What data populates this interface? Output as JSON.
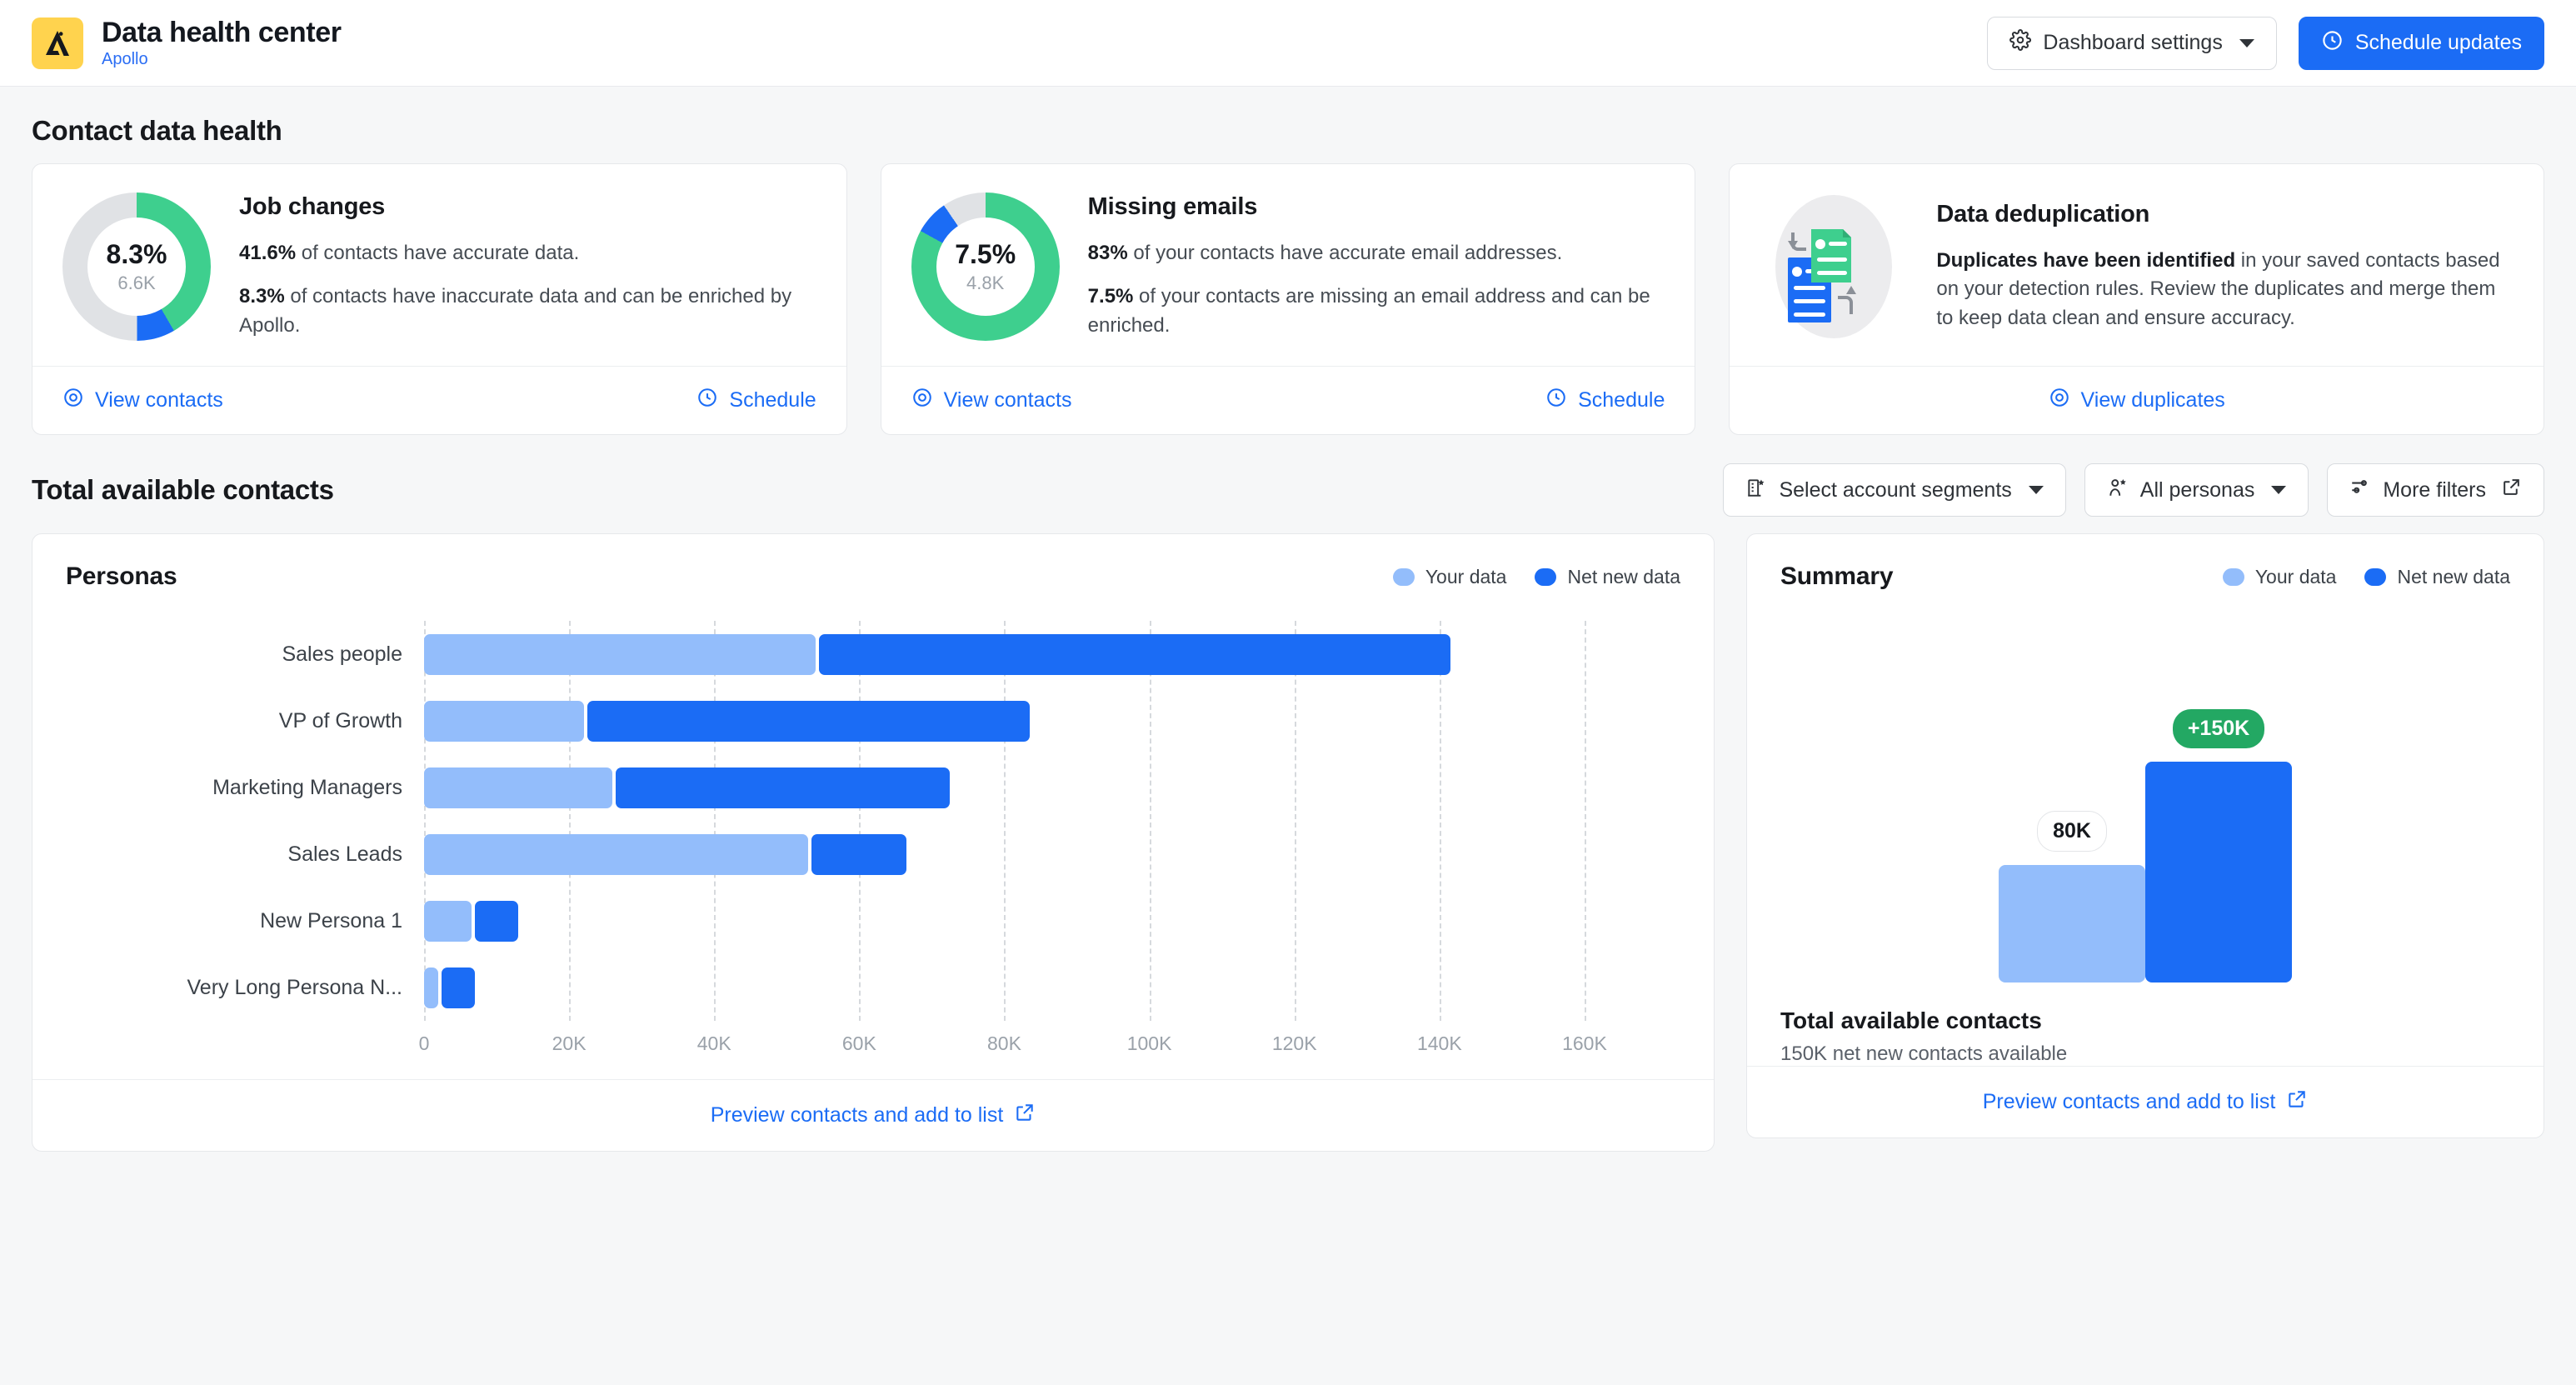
{
  "header": {
    "logo_icon": "apollo-logo-icon",
    "title": "Data health center",
    "subtitle": "Apollo",
    "settings_button": "Dashboard settings",
    "schedule_button": "Schedule updates"
  },
  "contact_health": {
    "section_title": "Contact data health",
    "cards": [
      {
        "id": "job-changes",
        "title": "Job changes",
        "donut": {
          "center_pct": "8.3%",
          "center_count": "6.6K",
          "green_pct": 41.6,
          "blue_pct": 8.3,
          "grey_pct": 50.1,
          "green_color": "#3ecf8e",
          "blue_color": "#1b6cf5",
          "grey_color": "#e0e2e5"
        },
        "line1_bold": "41.6%",
        "line1_rest": " of contacts have accurate data.",
        "line2_bold": "8.3%",
        "line2_rest": " of contacts have inaccurate data and can be enriched by Apollo.",
        "link_left": "View contacts",
        "link_left_icon": "eye-icon",
        "link_right": "Schedule",
        "link_right_icon": "clock-icon"
      },
      {
        "id": "missing-emails",
        "title": "Missing emails",
        "donut": {
          "center_pct": "7.5%",
          "center_count": "4.8K",
          "green_pct": 83.0,
          "blue_pct": 7.5,
          "grey_pct": 9.5,
          "green_color": "#3ecf8e",
          "blue_color": "#1b6cf5",
          "grey_color": "#e0e2e5"
        },
        "line1_bold": "83%",
        "line1_rest": " of your contacts have accurate email addresses.",
        "line2_bold": "7.5%",
        "line2_rest": " of your contacts are missing an email address and can be enriched.",
        "link_left": "View contacts",
        "link_left_icon": "eye-icon",
        "link_right": "Schedule",
        "link_right_icon": "clock-icon"
      },
      {
        "id": "data-deduplication",
        "title": "Data deduplication",
        "illustration_icon": "duplicate-documents-icon",
        "line1_bold": "Duplicates have been identified",
        "line1_rest": " in your saved contacts based on your detection rules. Review the duplicates and merge them to keep data clean and ensure accuracy.",
        "link_left": "View duplicates",
        "link_left_icon": "eye-icon"
      }
    ]
  },
  "available": {
    "section_title": "Total available contacts",
    "filters": [
      {
        "id": "select-account-segments",
        "label": "Select account segments",
        "icon": "building-star-icon",
        "trailing": "caret"
      },
      {
        "id": "all-personas",
        "label": "All personas",
        "icon": "persona-star-icon",
        "trailing": "caret"
      },
      {
        "id": "more-filters",
        "label": "More filters",
        "icon": "sliders-icon",
        "trailing": "external-link"
      }
    ],
    "personas_card": {
      "title": "Personas",
      "footer_link": "Preview contacts and add to list",
      "footer_link_icon": "external-link-icon"
    },
    "summary_card": {
      "title": "Summary",
      "footer_title": "Total available contacts",
      "footer_sub": "150K net new contacts available",
      "footer_link": "Preview contacts and add to list",
      "footer_link_icon": "external-link-icon"
    },
    "legend": [
      {
        "label": "Your data",
        "color": "#93bdfb"
      },
      {
        "label": "Net new data",
        "color": "#1b6cf5"
      }
    ]
  },
  "chart_data": [
    {
      "id": "personas-bar",
      "type": "bar",
      "orientation": "horizontal",
      "stacked": true,
      "title": "Personas",
      "xlabel": "",
      "ylabel": "",
      "xlim": [
        0,
        170
      ],
      "unit": "K contacts",
      "grid": true,
      "gridlines_x": [
        0,
        20,
        40,
        60,
        80,
        100,
        120,
        140,
        160
      ],
      "tick_labels": [
        "0",
        "20K",
        "40K",
        "60K",
        "80K",
        "100K",
        "120K",
        "140K",
        "160K"
      ],
      "legend_position": "top-right",
      "categories": [
        "Sales people",
        "VP of Growth",
        "Marketing Managers",
        "Sales Leads",
        "New Persona 1",
        "Very Long Persona N..."
      ],
      "series": [
        {
          "name": "Your data",
          "color": "#93bdfb",
          "values": [
            54,
            22,
            26,
            53,
            6.5,
            2
          ]
        },
        {
          "name": "Net new data",
          "color": "#1b6cf5",
          "values": [
            87,
            61,
            46,
            13,
            6,
            4.6
          ]
        }
      ]
    },
    {
      "id": "summary-bar",
      "type": "bar",
      "orientation": "vertical",
      "title": "Summary",
      "xlabel": "",
      "ylabel": "",
      "ylim": [
        0,
        170
      ],
      "unit": "K contacts",
      "grid": false,
      "legend_position": "top-right",
      "categories": [
        "Your data",
        "Net new data"
      ],
      "values": [
        80,
        150
      ],
      "data_labels": [
        "80K",
        "+150K"
      ],
      "colors": [
        "#93bdfb",
        "#1b6cf5"
      ],
      "label_colors": [
        "#15181d",
        "#ffffff"
      ],
      "label_backgrounds": [
        "#ffffff",
        "#23a863"
      ]
    }
  ]
}
